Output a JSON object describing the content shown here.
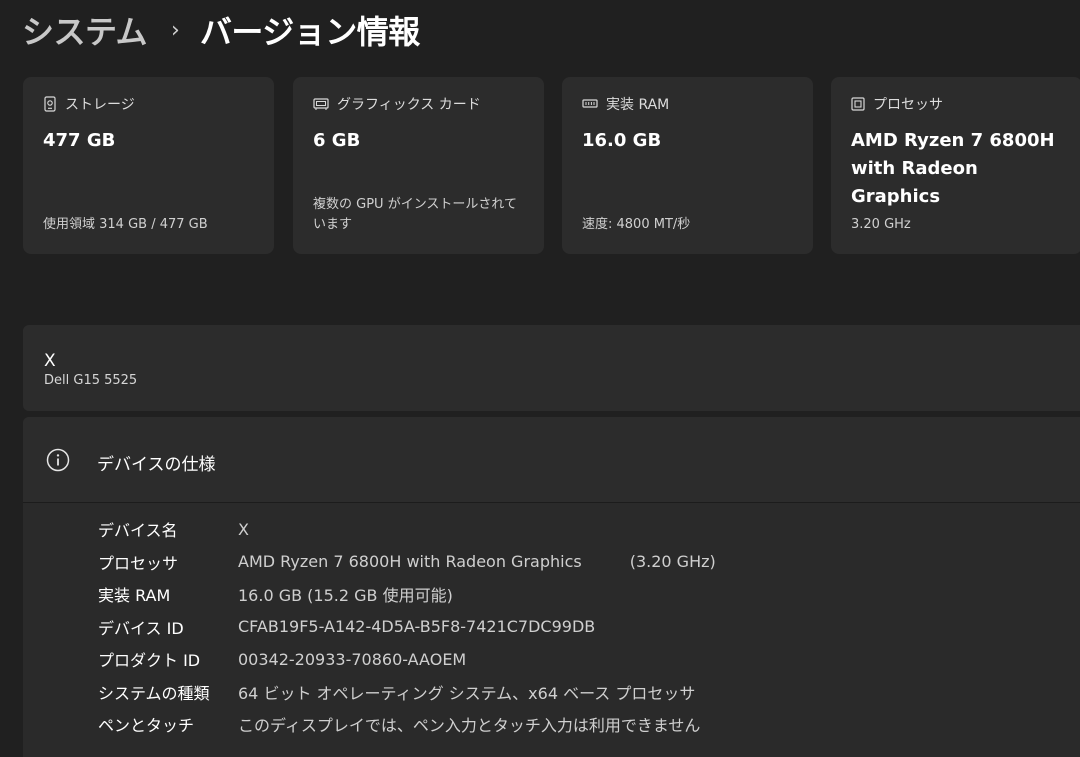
{
  "breadcrumb": {
    "parent": "システム",
    "separator": "›",
    "current": "バージョン情報"
  },
  "cards": {
    "storage": {
      "icon": "storage-icon",
      "label": "ストレージ",
      "value": "477 GB",
      "sub": "使用領域 314 GB / 477 GB"
    },
    "gpu": {
      "icon": "graphics-card-icon",
      "label": "グラフィックス カード",
      "value": "6 GB",
      "sub": "複数の GPU がインストールされています"
    },
    "ram": {
      "icon": "memory-icon",
      "label": "実装 RAM",
      "value": "16.0 GB",
      "sub": "速度: 4800 MT/秒"
    },
    "cpu": {
      "icon": "processor-icon",
      "label": "プロセッサ",
      "value": "AMD Ryzen 7 6800H with Radeon Graphics",
      "sub": "3.20 GHz"
    }
  },
  "device": {
    "name": "X",
    "model": "Dell G15 5525"
  },
  "specs": {
    "icon": "info-icon",
    "title": "デバイスの仕様",
    "rows": [
      {
        "label": "デバイス名",
        "value": "X"
      },
      {
        "label": "プロセッサ",
        "value": "AMD Ryzen 7 6800H with Radeon Graphics",
        "extra": "(3.20 GHz)"
      },
      {
        "label": "実装 RAM",
        "value": "16.0 GB (15.2 GB 使用可能)"
      },
      {
        "label": "デバイス ID",
        "value": "CFAB19F5-A142-4D5A-B5F8-7421C7DC99DB"
      },
      {
        "label": "プロダクト ID",
        "value": "00342-20933-70860-AAOEM"
      },
      {
        "label": "システムの種類",
        "value": "64 ビット オペレーティング システム、x64 ベース プロセッサ"
      },
      {
        "label": "ペンとタッチ",
        "value": "このディスプレイでは、ペン入力とタッチ入力は利用できません"
      }
    ]
  }
}
